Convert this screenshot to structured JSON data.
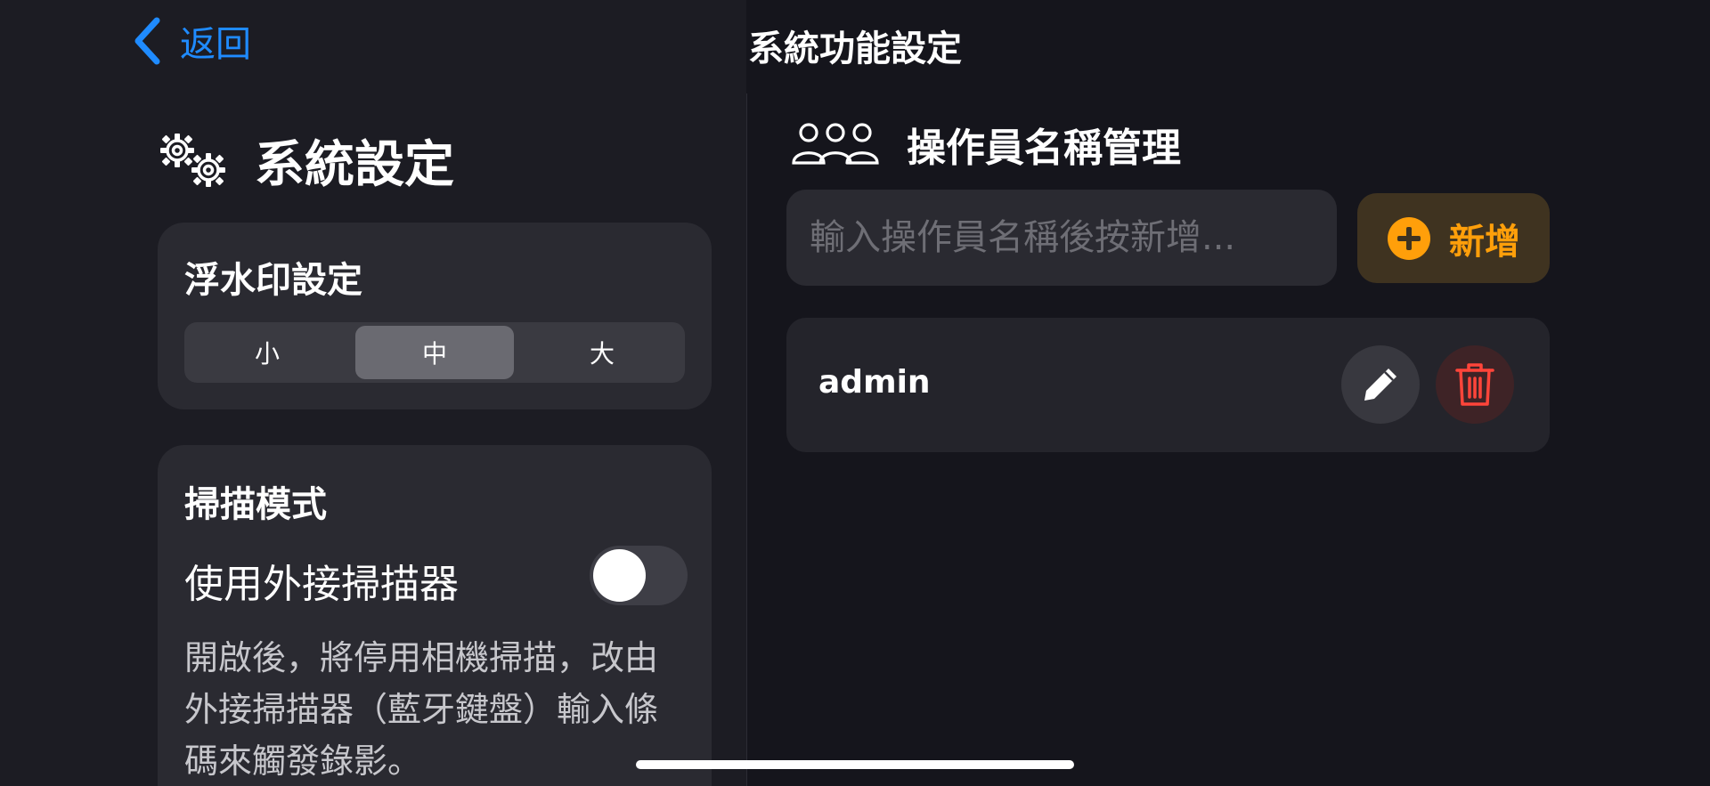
{
  "nav": {
    "back_label": "返回",
    "title": "系統功能設定"
  },
  "system_settings": {
    "title": "系統設定",
    "icon": "gears-icon",
    "watermark": {
      "title": "浮水印設定",
      "options": [
        "小",
        "中",
        "大"
      ],
      "selected": "中"
    },
    "scan_mode": {
      "title": "掃描模式",
      "toggle_label": "使用外接掃描器",
      "toggle_on": false,
      "description": "開啟後，將停用相機掃描，改由外接掃描器（藍牙鍵盤）輸入條碼來觸發錄影。"
    }
  },
  "operators": {
    "title": "操作員名稱管理",
    "icon": "people-icon",
    "input_placeholder": "輸入操作員名稱後按新增...",
    "input_value": "",
    "add_label": "新增",
    "list": [
      {
        "name": "admin"
      }
    ]
  },
  "colors": {
    "accent_blue": "#1f8bff",
    "accent_orange": "#ff9f0a",
    "danger_red": "#ff453a"
  }
}
